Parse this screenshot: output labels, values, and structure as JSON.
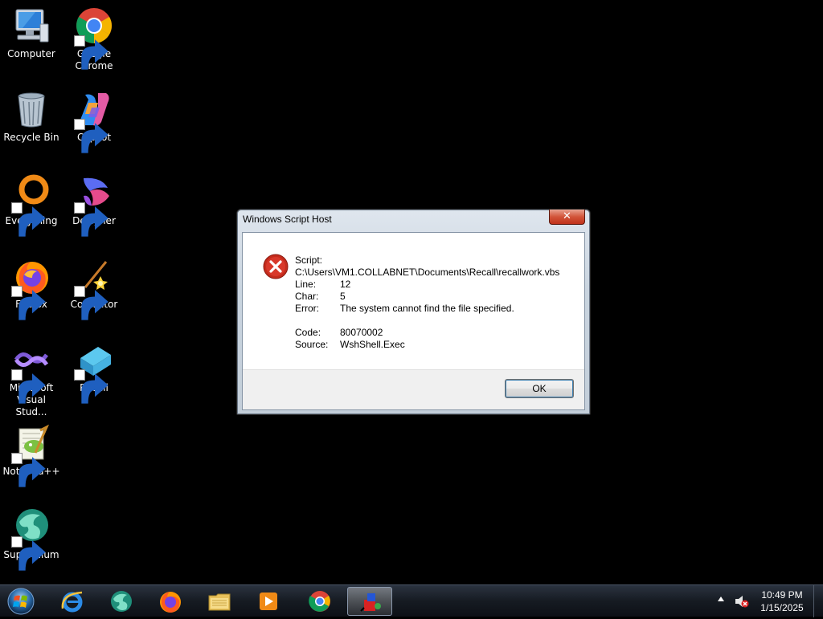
{
  "desktop": {
    "icons": [
      {
        "label": "Computer",
        "icon": "computer-icon"
      },
      {
        "label": "Google Chrome",
        "icon": "chrome-icon"
      },
      {
        "label": "Recycle Bin",
        "icon": "recycle-bin-icon"
      },
      {
        "label": "Copilot",
        "icon": "copilot-icon"
      },
      {
        "label": "Everything",
        "icon": "everything-icon"
      },
      {
        "label": "Designer",
        "icon": "designer-icon"
      },
      {
        "label": "Firefox",
        "icon": "firefox-icon"
      },
      {
        "label": "Cocreator",
        "icon": "cocreator-icon"
      },
      {
        "label": "Microsoft Visual Stud...",
        "icon": "visual-studio-icon"
      },
      {
        "label": "Recall",
        "icon": "recall-icon"
      },
      {
        "label": "Notepad++",
        "icon": "notepadpp-icon"
      },
      {
        "label": "Supermium",
        "icon": "supermium-icon"
      }
    ]
  },
  "dialog": {
    "title": "Windows Script Host",
    "close_label": "✕",
    "script_label": "Script:",
    "script_path": "C:\\Users\\VM1.COLLABNET\\Documents\\Recall\\recallwork.vbs",
    "line_label": "Line:",
    "line_value": "12",
    "char_label": "Char:",
    "char_value": "5",
    "error_label": "Error:",
    "error_value": "The system cannot find the file specified.",
    "code_label": "Code:",
    "code_value": "80070002",
    "source_label": "Source:",
    "source_value": "WshShell.Exec",
    "ok_label": "OK"
  },
  "taskbar": {
    "pinned": [
      {
        "name": "internet-explorer-icon"
      },
      {
        "name": "supermium-icon"
      },
      {
        "name": "firefox-icon"
      },
      {
        "name": "file-explorer-icon"
      },
      {
        "name": "media-player-icon"
      },
      {
        "name": "chrome-icon"
      },
      {
        "name": "script-host-icon",
        "active": true
      }
    ],
    "clock": {
      "time": "10:49 PM",
      "date": "1/15/2025"
    }
  },
  "colors": {
    "desktop_background": "#000000",
    "error_red": "#c42b1c",
    "title_bar": "#c9d4df"
  }
}
